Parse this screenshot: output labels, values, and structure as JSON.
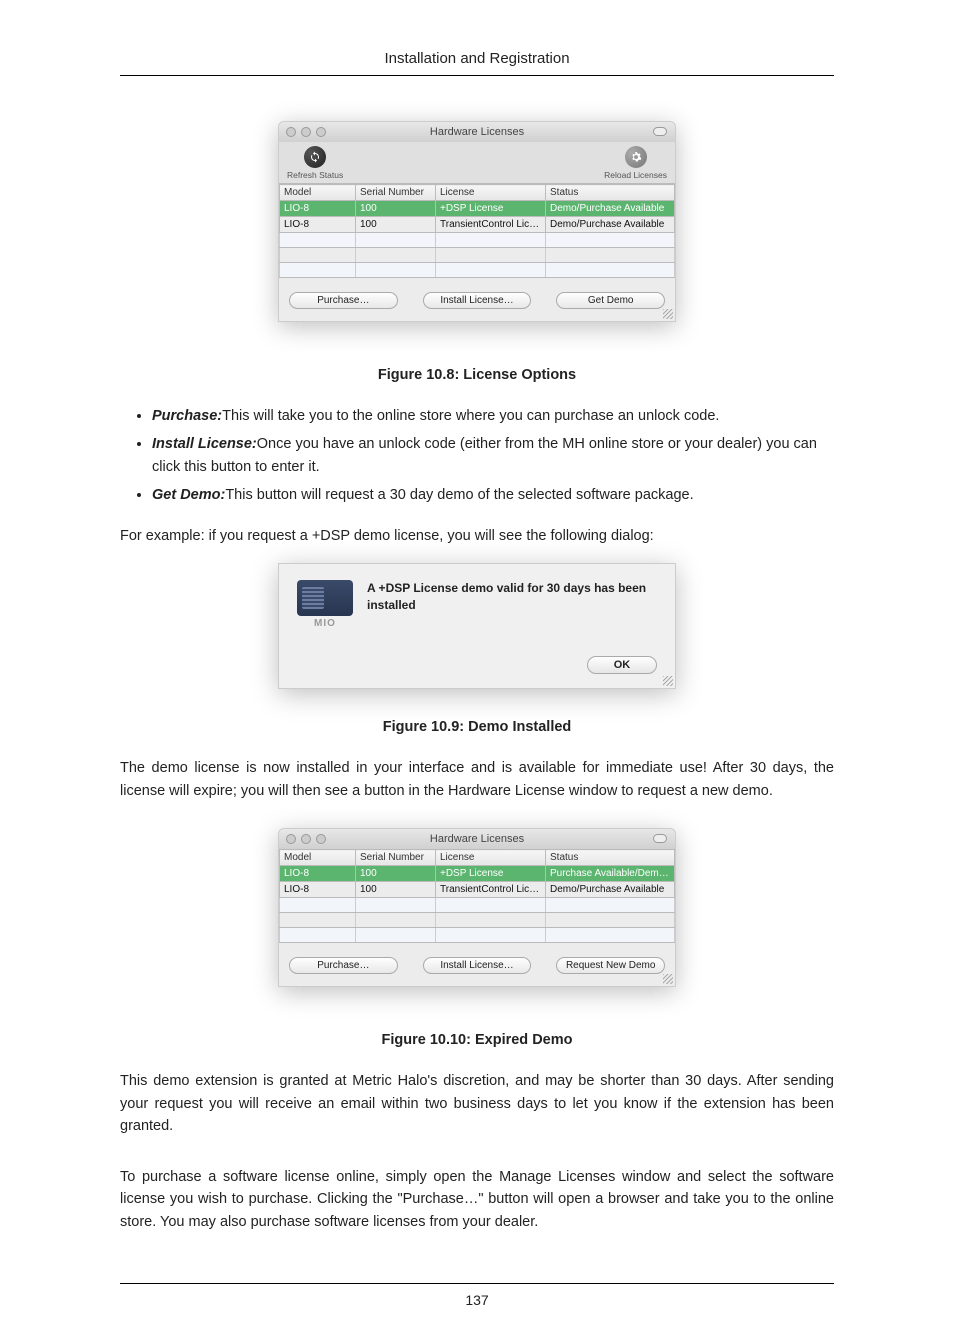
{
  "header": "Installation and Registration",
  "page_number": "137",
  "fig1": {
    "window_title": "Hardware Licenses",
    "left_tool": "Refresh Status",
    "right_tool": "Reload Licenses",
    "headers": [
      "Model",
      "Serial Number",
      "License",
      "Status"
    ],
    "rows": [
      {
        "cells": [
          "LIO-8",
          "100",
          "+DSP License",
          "Demo/Purchase Available"
        ],
        "green": true
      },
      {
        "cells": [
          "LIO-8",
          "100",
          "TransientControl Lic…",
          "Demo/Purchase Available"
        ],
        "green": false
      }
    ],
    "buttons": [
      "Purchase…",
      "Install License…",
      "Get Demo"
    ],
    "caption": "Figure 10.8: License Options"
  },
  "bullets": [
    {
      "term": "Purchase:",
      "desc": "This will take you to the online store where you can purchase an unlock code."
    },
    {
      "term": "Install License:",
      "desc": "Once you have an unlock code (either from the MH online store or your dealer) you can click this button to enter it."
    },
    {
      "term": "Get Demo:",
      "desc": "This button will request a 30 day demo of the selected software package."
    }
  ],
  "para1": "For example: if you request a +DSP demo license, you will see the following dialog:",
  "dialog": {
    "text": "A +DSP License demo valid for 30 days has been installed",
    "brand": "MIO",
    "ok": "OK",
    "caption": "Figure 10.9: Demo Installed"
  },
  "para2": "The demo license is now installed in your interface and is available for immediate use! After 30 days, the license will expire; you will then see a button in the Hardware License window to request a new demo.",
  "fig3": {
    "window_title": "Hardware Licenses",
    "headers": [
      "Model",
      "Serial Number",
      "License",
      "Status"
    ],
    "rows": [
      {
        "cells": [
          "LIO-8",
          "100",
          "+DSP License",
          "Purchase Available/Dem…"
        ],
        "green": true
      },
      {
        "cells": [
          "LIO-8",
          "100",
          "TransientControl Lic…",
          "Demo/Purchase Available"
        ],
        "green": false
      }
    ],
    "buttons": [
      "Purchase…",
      "Install License…",
      "Request New Demo"
    ],
    "caption": "Figure 10.10: Expired Demo"
  },
  "para3": "This demo extension is granted at Metric Halo's discretion, and may be shorter than 30 days. After sending your request you will receive an email within two business days to let you know if the extension has been granted.",
  "para4": "To purchase a software license online, simply open the Manage Licenses window and select the software license you wish to purchase. Clicking the \"Purchase…\" button will open a browser and take you to the online store. You may also purchase software licenses from your dealer."
}
